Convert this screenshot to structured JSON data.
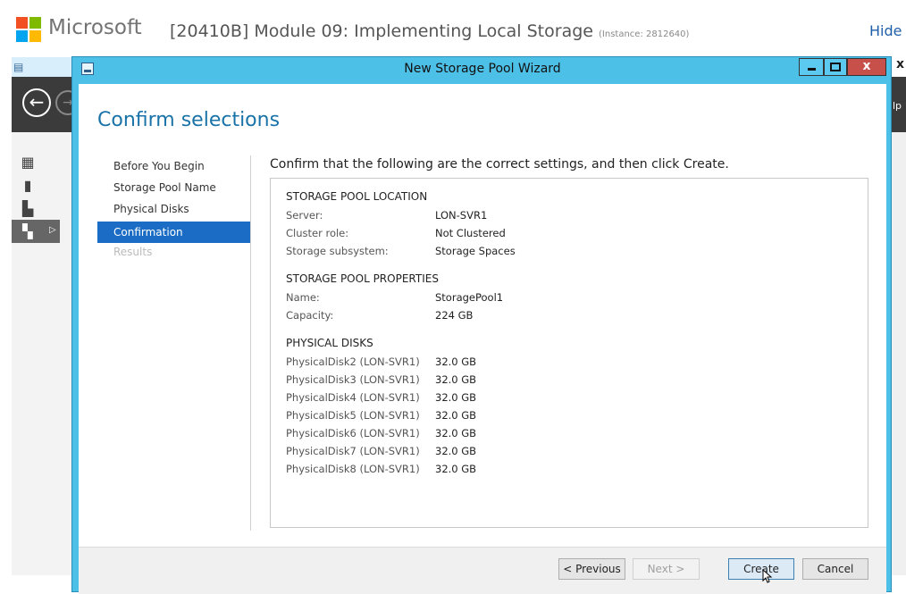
{
  "host": {
    "brand": "Microsoft",
    "lab_title": "[20410B] Module 09: Implementing Local Storage",
    "instance": "(Instance: 2812640)",
    "hide_link": "Hide r"
  },
  "background": {
    "right_nav_text": "lp",
    "right_close": "x"
  },
  "window": {
    "title": "New Storage Pool Wizard",
    "min_label": "minimize",
    "max_label": "maximize",
    "close_glyph": "x"
  },
  "page": {
    "heading": "Confirm selections",
    "instruction": "Confirm that the following are the correct settings, and then click Create."
  },
  "steps": [
    {
      "label": "Before You Begin",
      "state": "normal"
    },
    {
      "label": "Storage Pool Name",
      "state": "normal"
    },
    {
      "label": "Physical Disks",
      "state": "normal"
    },
    {
      "label": "Confirmation",
      "state": "active"
    },
    {
      "label": "Results",
      "state": "disabled"
    }
  ],
  "location": {
    "title": "STORAGE POOL LOCATION",
    "rows": [
      {
        "key": "Server:",
        "value": "LON-SVR1"
      },
      {
        "key": "Cluster role:",
        "value": "Not Clustered"
      },
      {
        "key": "Storage subsystem:",
        "value": "Storage Spaces"
      }
    ]
  },
  "properties": {
    "title": "STORAGE POOL PROPERTIES",
    "rows": [
      {
        "key": "Name:",
        "value": "StoragePool1"
      },
      {
        "key": "Capacity:",
        "value": "224 GB"
      }
    ]
  },
  "disks": {
    "title": "PHYSICAL DISKS",
    "rows": [
      {
        "key": "PhysicalDisk2 (LON-SVR1)",
        "value": "32.0 GB"
      },
      {
        "key": "PhysicalDisk3 (LON-SVR1)",
        "value": "32.0 GB"
      },
      {
        "key": "PhysicalDisk4 (LON-SVR1)",
        "value": "32.0 GB"
      },
      {
        "key": "PhysicalDisk5 (LON-SVR1)",
        "value": "32.0 GB"
      },
      {
        "key": "PhysicalDisk6 (LON-SVR1)",
        "value": "32.0 GB"
      },
      {
        "key": "PhysicalDisk7 (LON-SVR1)",
        "value": "32.0 GB"
      },
      {
        "key": "PhysicalDisk8 (LON-SVR1)",
        "value": "32.0 GB"
      }
    ]
  },
  "buttons": {
    "previous": "< Previous",
    "next": "Next >",
    "create": "Create",
    "cancel": "Cancel"
  },
  "colors": {
    "accent": "#1b6cc4",
    "title_bar": "#4dc0e8",
    "heading": "#1a73a8"
  }
}
